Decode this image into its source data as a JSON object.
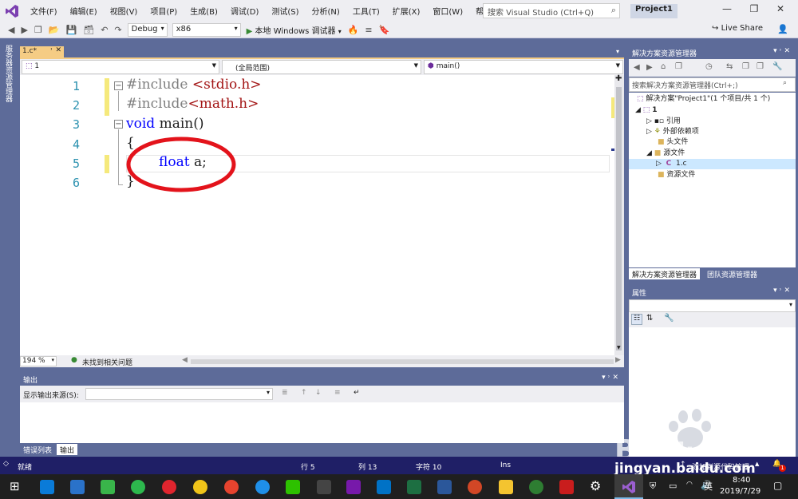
{
  "menubar": {
    "items": [
      "文件(F)",
      "编辑(E)",
      "视图(V)",
      "项目(P)",
      "生成(B)",
      "调试(D)",
      "测试(S)",
      "分析(N)",
      "工具(T)",
      "扩展(X)",
      "窗口(W)",
      "帮助(H)"
    ],
    "search_placeholder": "搜索 Visual Studio (Ctrl+Q)",
    "project_name": "Project1"
  },
  "toolbar": {
    "config": "Debug",
    "platform": "x86",
    "run_label": "本地 Windows 调试器",
    "live_share": "Live Share"
  },
  "left_strip": {
    "label": "服务器资源管理器"
  },
  "editor": {
    "tab_name": "1.c*",
    "nav_project": "1",
    "nav_scope": "(全局范围)",
    "nav_member": "main()",
    "line_numbers": [
      "1",
      "2",
      "3",
      "4",
      "5",
      "6"
    ],
    "lines": {
      "l1_directive": "#include",
      "l1_header": "<stdio.h>",
      "l2_directive": "#include",
      "l2_header": "<math.h>",
      "l3_keyword": "void",
      "l3_rest": "main()",
      "l4": "{",
      "l5_keyword": "float",
      "l5_rest": "a;",
      "l6": "}"
    },
    "zoom": "194 %",
    "issues": "未找到相关问题"
  },
  "output": {
    "title": "输出",
    "source_label": "显示输出来源(S):",
    "tabs": [
      "错误列表",
      "输出"
    ]
  },
  "solution_explorer": {
    "title": "解决方案资源管理器",
    "search_placeholder": "搜索解决方案资源管理器(Ctrl+;)",
    "tree": {
      "solution": "解决方案\"Project1\"(1 个项目/共 1 个)",
      "project": "1",
      "references": "引用",
      "external_deps": "外部依赖项",
      "header_files": "头文件",
      "source_files": "源文件",
      "file_1c": "1.c",
      "resource_files": "资源文件"
    },
    "tabs": [
      "解决方案资源管理器",
      "团队资源管理器"
    ]
  },
  "properties": {
    "title": "属性"
  },
  "statusbar": {
    "ready": "就绪",
    "line": "行 5",
    "col": "列 13",
    "char": "字符 10",
    "mode": "Ins",
    "add_source": "添加到源代码管理",
    "notifications": "1"
  },
  "taskbar": {
    "time": "8:40",
    "date": "2019/7/29",
    "ime": "英"
  },
  "watermark": {
    "text": "jingyan.baidu.com"
  },
  "colors": {
    "accent": "#5d6b99",
    "status_bar": "#1f1f66",
    "keyword": "#0000ff",
    "string": "#a31515",
    "line_number": "#2b91af",
    "annotation_circle": "#e3131b"
  }
}
